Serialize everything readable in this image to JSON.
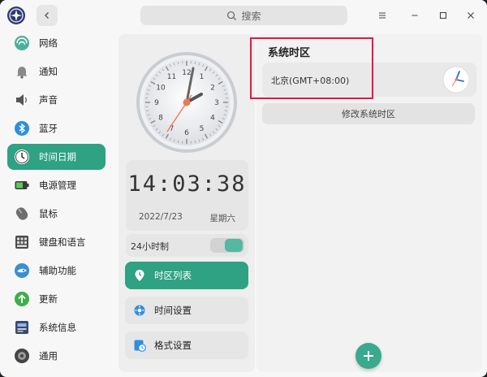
{
  "titlebar": {
    "search_placeholder": "搜索",
    "back_icon": "chevron-left-icon",
    "menu_icon": "hamburger-icon",
    "minimize_icon": "minimize-icon",
    "maximize_icon": "maximize-icon",
    "close_icon": "close-icon"
  },
  "sidebar": {
    "items": [
      {
        "label": "网络",
        "icon": "network-icon"
      },
      {
        "label": "通知",
        "icon": "bell-icon"
      },
      {
        "label": "声音",
        "icon": "speaker-icon"
      },
      {
        "label": "蓝牙",
        "icon": "bluetooth-icon"
      },
      {
        "label": "时间日期",
        "icon": "clock-icon",
        "active": true
      },
      {
        "label": "电源管理",
        "icon": "battery-icon"
      },
      {
        "label": "鼠标",
        "icon": "mouse-icon"
      },
      {
        "label": "键盘和语言",
        "icon": "keyboard-icon"
      },
      {
        "label": "辅助功能",
        "icon": "accessibility-icon"
      },
      {
        "label": "更新",
        "icon": "update-icon"
      },
      {
        "label": "系统信息",
        "icon": "system-info-icon"
      },
      {
        "label": "通用",
        "icon": "general-icon"
      }
    ]
  },
  "datetime": {
    "digital_time": "14:03:38",
    "date": "2022/7/23",
    "weekday": "星期六",
    "format_24h_label": "24小时制",
    "format_24h_on": true
  },
  "menu": {
    "timezone_list": "时区列表",
    "time_settings": "时间设置",
    "format_settings": "格式设置"
  },
  "timezone": {
    "title": "系统时区",
    "current": "北京(GMT+08:00)",
    "change_button": "修改系统时区"
  },
  "colors": {
    "accent": "#2ea283",
    "highlight_border": "#e5173f"
  }
}
